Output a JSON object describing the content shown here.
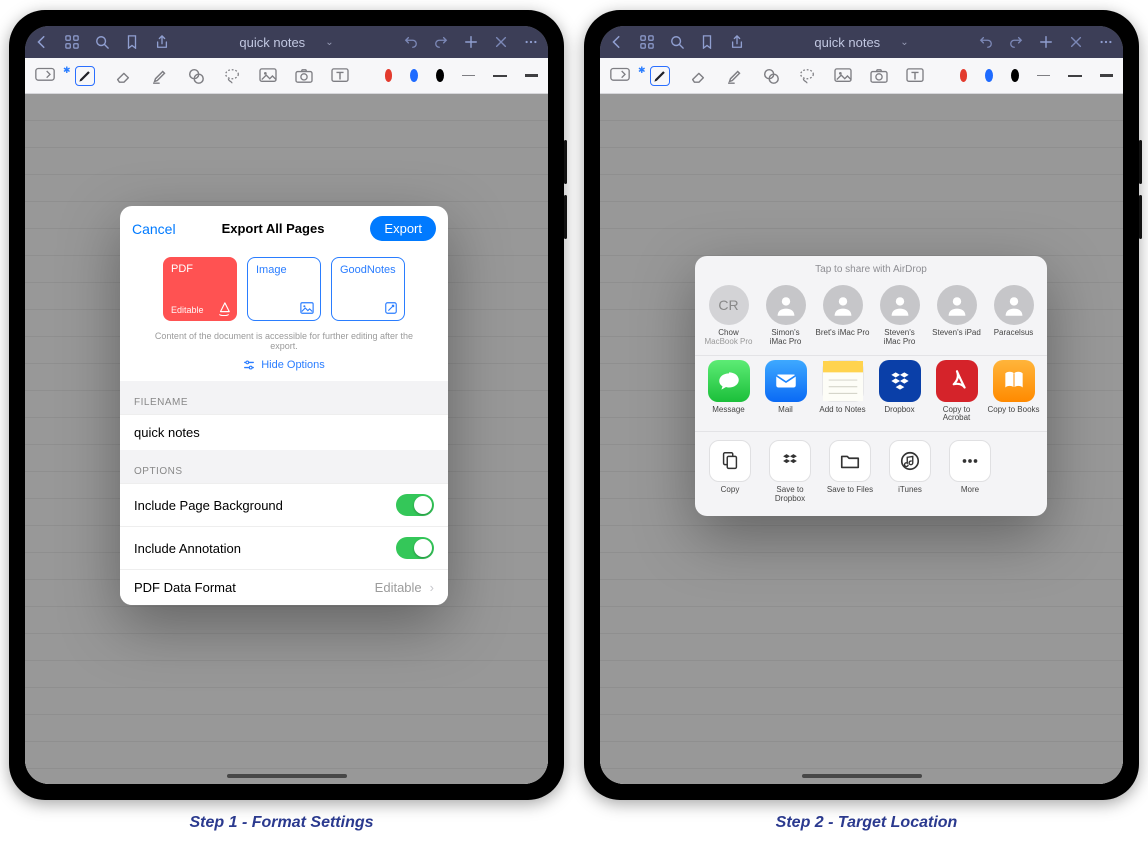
{
  "document": {
    "title": "quick notes"
  },
  "nav_icons": [
    "back",
    "grid",
    "search",
    "bookmark",
    "share",
    "undo",
    "redo",
    "add",
    "close",
    "more"
  ],
  "toolbar_items": [
    "lasso-toggle",
    "pen",
    "eraser",
    "highlighter",
    "shapes",
    "lasso",
    "image",
    "camera",
    "text-box"
  ],
  "color_swatches": [
    "#e33b2e",
    "#1f6bff",
    "#000000"
  ],
  "captions": {
    "left": "Step 1 - Format Settings",
    "right": "Step 2 - Target Location"
  },
  "export_dialog": {
    "cancel": "Cancel",
    "title": "Export All Pages",
    "export": "Export",
    "formats": [
      {
        "name": "PDF",
        "subtitle": "Editable",
        "selected": true
      },
      {
        "name": "Image"
      },
      {
        "name": "GoodNotes"
      }
    ],
    "hint": "Content of the document is accessible for further editing after the export.",
    "hide_options": "Hide Options",
    "filename_label": "FILENAME",
    "filename_value": "quick notes",
    "options_label": "OPTIONS",
    "options": [
      {
        "label": "Include Page Background",
        "type": "toggle",
        "value": true
      },
      {
        "label": "Include Annotation",
        "type": "toggle",
        "value": true
      },
      {
        "label": "PDF Data Format",
        "type": "detail",
        "detail": "Editable"
      }
    ]
  },
  "share_sheet": {
    "header": "Tap to share with AirDrop",
    "airdrop": [
      {
        "initials": "CR",
        "name": "Chow",
        "sub": "MacBook Pro"
      },
      {
        "name": "Simon's",
        "sub": "iMac Pro"
      },
      {
        "name": "Bret's iMac Pro"
      },
      {
        "name": "Steven's",
        "sub": "iMac Pro"
      },
      {
        "name": "Steven's iPad"
      },
      {
        "name": "Paracelsus"
      }
    ],
    "apps": [
      {
        "name": "Message",
        "color": "#36d759",
        "glyph": "bubble"
      },
      {
        "name": "Mail",
        "color": "#1d86ff",
        "glyph": "mail"
      },
      {
        "name": "Add to Notes",
        "color": "#ffffff",
        "glyph": "notes"
      },
      {
        "name": "Dropbox",
        "color": "#0a3fa8",
        "glyph": "dropbox"
      },
      {
        "name": "Copy to Acrobat",
        "color": "#d5232a",
        "glyph": "acrobat"
      },
      {
        "name": "Copy to Books",
        "color": "#ff8a00",
        "glyph": "books"
      }
    ],
    "actions": [
      {
        "name": "Copy",
        "glyph": "copy"
      },
      {
        "name": "Save to Dropbox",
        "glyph": "dropbox-bw"
      },
      {
        "name": "Save to Files",
        "glyph": "folder"
      },
      {
        "name": "iTunes",
        "glyph": "itunes"
      },
      {
        "name": "More",
        "glyph": "more"
      }
    ]
  }
}
